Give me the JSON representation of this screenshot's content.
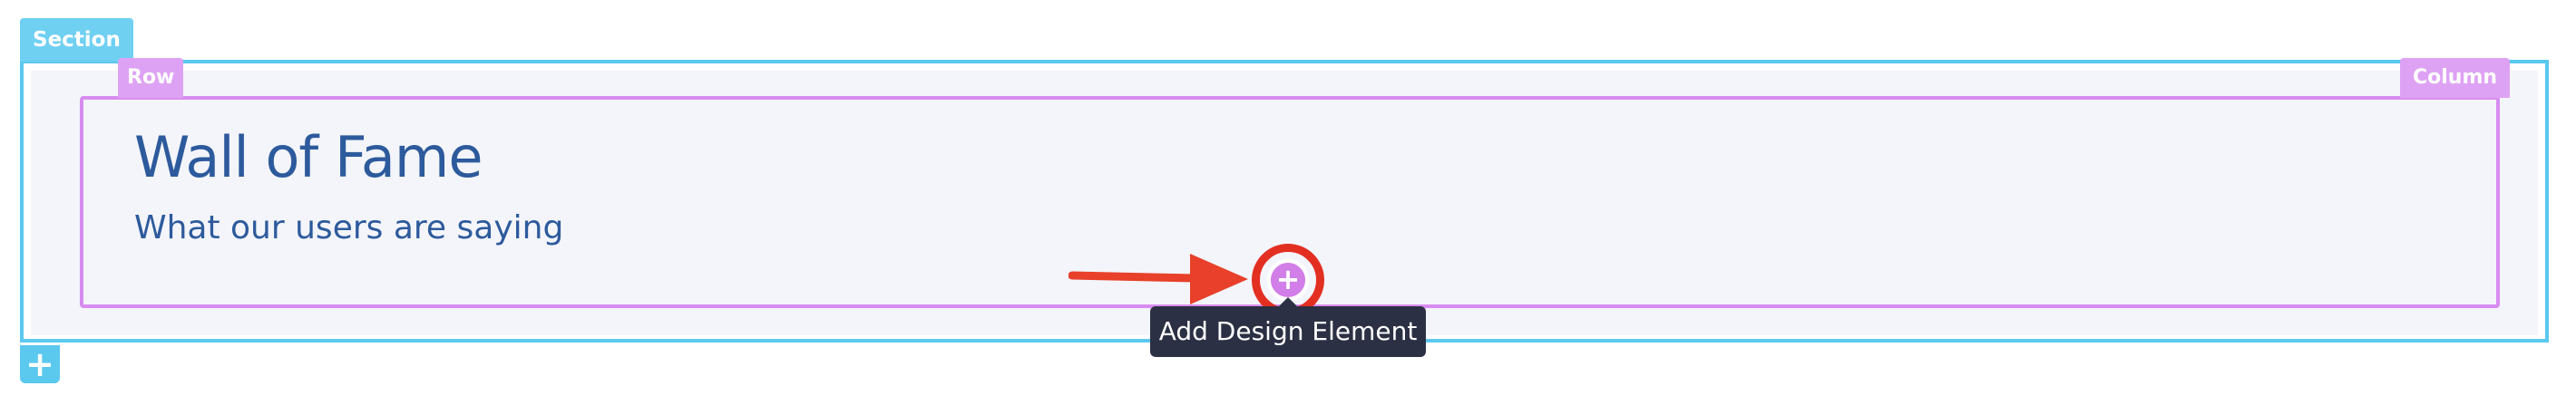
{
  "builder": {
    "section_label": "Section",
    "row_label": "Row",
    "column_label": "Column",
    "add_section_icon": "+",
    "add_element_icon": "+",
    "tooltip": "Add Design Element"
  },
  "content": {
    "heading": "Wall of Fame",
    "subheading": "What our users are saying"
  },
  "colors": {
    "section": "#5bc8ee",
    "row": "#d88cf0",
    "heading": "#2d5a9c",
    "highlight": "#e22f22",
    "tooltip_bg": "#2b3044"
  }
}
